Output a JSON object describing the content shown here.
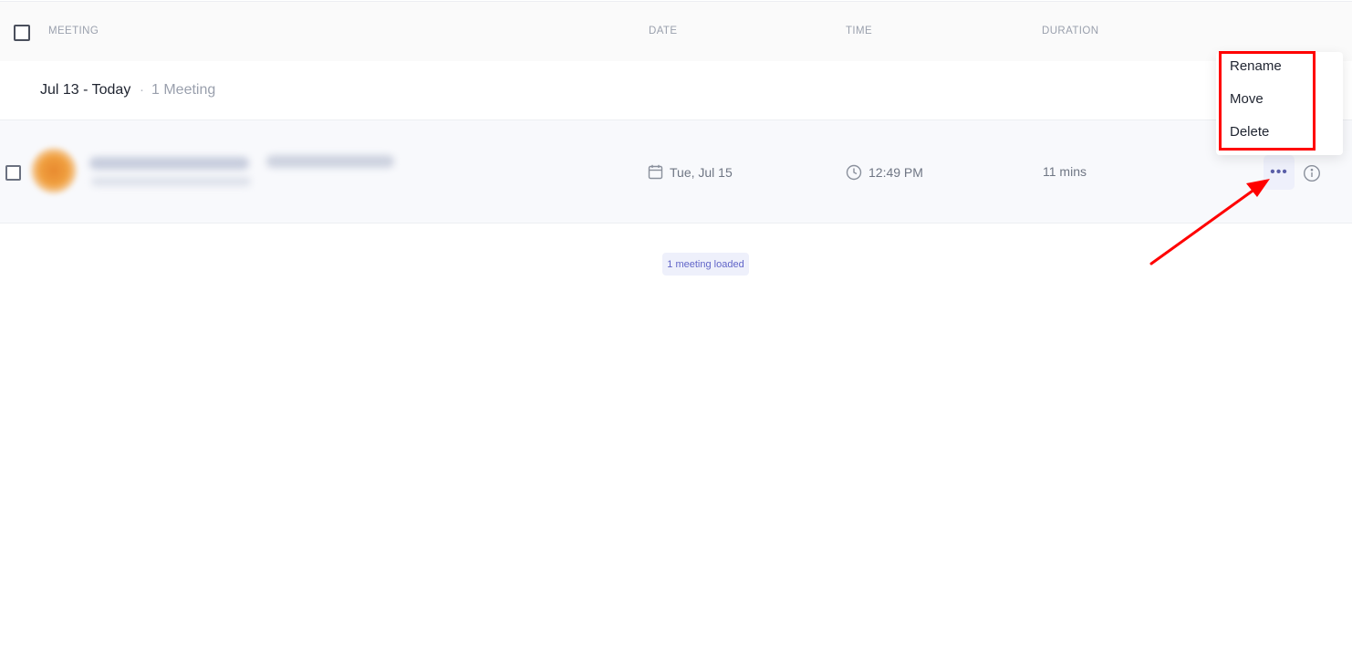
{
  "table_header": {
    "meeting": "MEETING",
    "date": "DATE",
    "time": "TIME",
    "duration": "DURATION"
  },
  "group": {
    "title": "Jul 13 - Today",
    "separator": "·",
    "count": "1 Meeting"
  },
  "meeting_row": {
    "date": "Tue, Jul 15",
    "time": "12:49 PM",
    "duration": "11 mins",
    "more_label": "•••"
  },
  "status": {
    "loaded": "1 meeting loaded"
  },
  "context_menu": {
    "items": [
      {
        "label": "Rename"
      },
      {
        "label": "Move"
      },
      {
        "label": "Delete"
      }
    ]
  },
  "colors": {
    "accent": "#6165c8",
    "annotation": "#ff0000"
  },
  "icons": {
    "date": "calendar-icon",
    "time": "clock-icon",
    "info": "info-icon",
    "more": "more-horizontal-icon"
  }
}
